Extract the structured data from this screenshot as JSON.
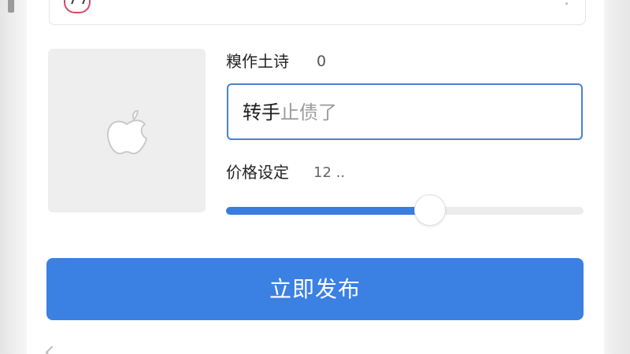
{
  "form": {
    "title_label": "糗作土诗",
    "title_count": "0",
    "title_input": {
      "typed": "转手",
      "placeholder": "止债了"
    },
    "price_label": "价格设定",
    "price_value": "12 ..",
    "price_slider_fraction": 0.57,
    "image_placeholder_icon": "apple-icon"
  },
  "publish_button": {
    "label": "立即发布"
  },
  "colors": {
    "accent": "#3b80e3",
    "input_border": "#4a82cf",
    "placeholder_gray": "#9a9a9a"
  }
}
